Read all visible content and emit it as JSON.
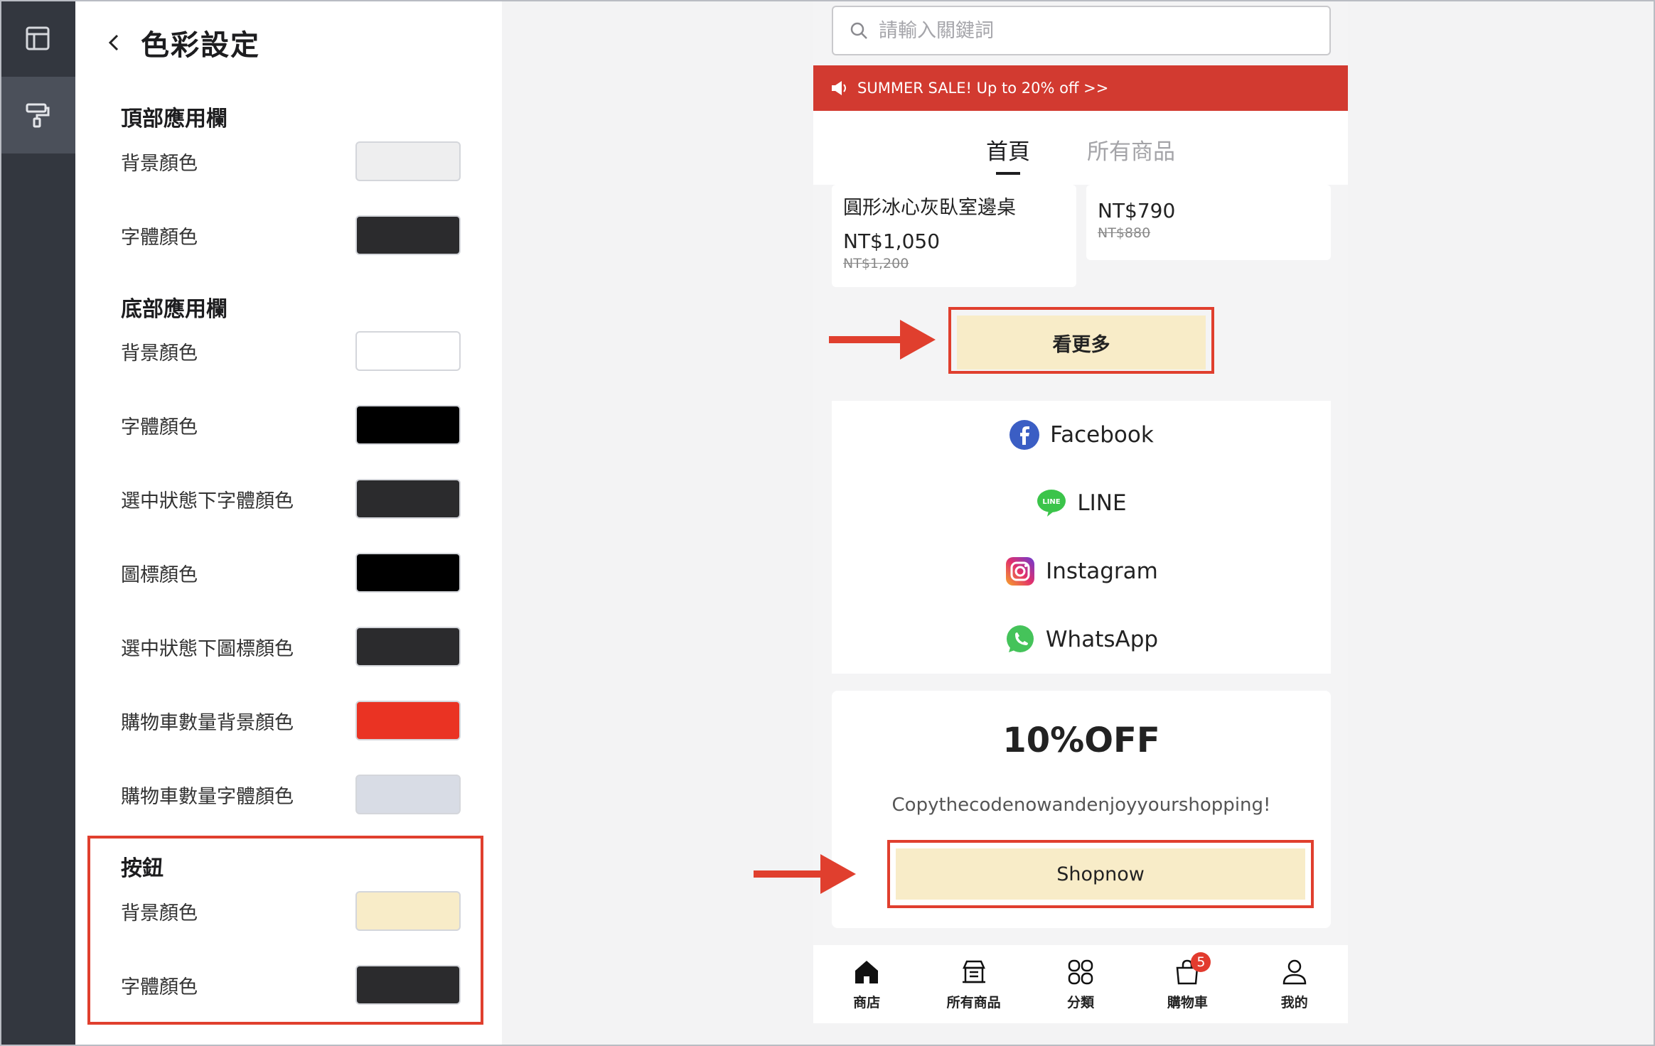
{
  "panel": {
    "title": "色彩設定",
    "sections": {
      "top_bar": {
        "title": "頂部應用欄",
        "rows": [
          {
            "label": "背景顏色",
            "color": "#eeeeef"
          },
          {
            "label": "字體顏色",
            "color": "#2b2b2d"
          }
        ]
      },
      "bottom_bar": {
        "title": "底部應用欄",
        "rows": [
          {
            "label": "背景顏色",
            "color": "#ffffff"
          },
          {
            "label": "字體顏色",
            "color": "#000000"
          },
          {
            "label": "選中狀態下字體顏色",
            "color": "#2b2b2d"
          },
          {
            "label": "圖標顏色",
            "color": "#000000"
          },
          {
            "label": "選中狀態下圖標顏色",
            "color": "#2b2b2d"
          },
          {
            "label": "購物車數量背景顏色",
            "color": "#ea3323"
          },
          {
            "label": "購物車數量字體顏色",
            "color": "#d8dce5"
          }
        ]
      },
      "button": {
        "title": "按鈕",
        "rows": [
          {
            "label": "背景顏色",
            "color": "#f8ecc8"
          },
          {
            "label": "字體顏色",
            "color": "#2b2b2d"
          }
        ]
      }
    }
  },
  "preview": {
    "search_placeholder": "請輸入關鍵詞",
    "promo": "SUMMER SALE! Up to 20% off >>",
    "tabs": [
      "首頁",
      "所有商品"
    ],
    "products": [
      {
        "name": "圓形冰心灰臥室邊桌",
        "price": "NT$1,050",
        "old_price": "NT$1,200"
      },
      {
        "price": "NT$790",
        "old_price": "NT$880"
      }
    ],
    "more_button": "看更多",
    "social": [
      "Facebook",
      "LINE",
      "Instagram",
      "WhatsApp"
    ],
    "coupon": {
      "title": "10%OFF",
      "description": "Copythecodenowandenjoyyourshopping!",
      "button": "Shopnow"
    },
    "bottom_nav": [
      {
        "label": "商店",
        "icon": "home-icon"
      },
      {
        "label": "所有商品",
        "icon": "store-icon"
      },
      {
        "label": "分類",
        "icon": "category-icon"
      },
      {
        "label": "購物車",
        "icon": "cart-icon",
        "badge": "5"
      },
      {
        "label": "我的",
        "icon": "user-icon"
      }
    ]
  },
  "colors": {
    "accent_red": "#e03f2e",
    "promo_red": "#d23a30",
    "button_bg": "#f8ecc8"
  }
}
